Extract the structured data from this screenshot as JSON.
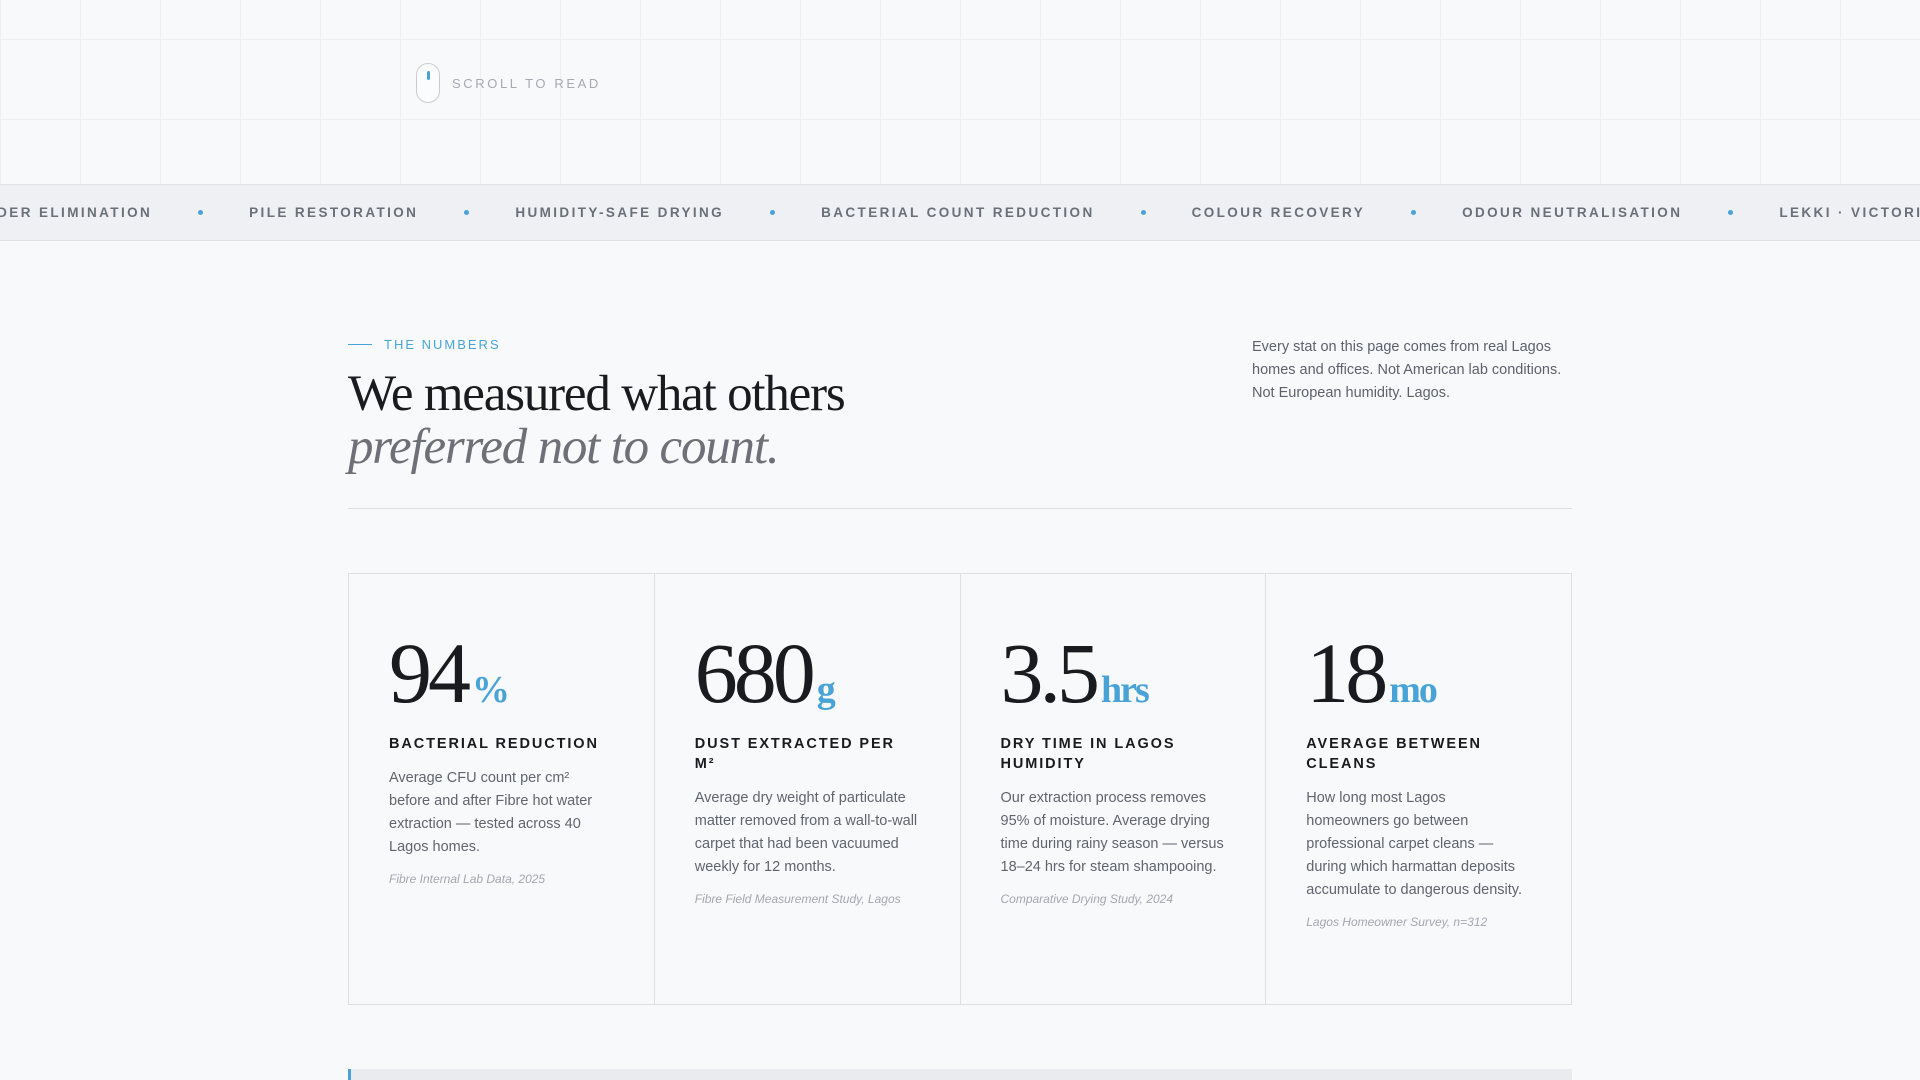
{
  "hero": {
    "scroll_label": "Scroll to read"
  },
  "ticker": {
    "items": [
      "nder elimination",
      "Pile restoration",
      "Humidity-safe drying",
      "Bacterial count reduction",
      "Colour recovery",
      "Odour neutralisation",
      "Lekki · Victoria Island · Ikoyi · Ajah · Magodo"
    ],
    "accent": "#4aa3d6"
  },
  "section": {
    "eyebrow": "The numbers",
    "headline_line1": "We measured what others",
    "headline_line2": "preferred not to count.",
    "intro": "Every stat on this page comes from real Lagos homes and offices. Not American lab conditions. Not European humidity. Lagos."
  },
  "stats": [
    {
      "value": "94",
      "unit": "%",
      "label": "Bacterial reduction",
      "description": "Average CFU count per cm² before and after Fibre hot water extraction — tested across 40 Lagos homes.",
      "source": "Fibre Internal Lab Data, 2025"
    },
    {
      "value": "680",
      "unit": "g",
      "label": "Dust extracted per m²",
      "description": "Average dry weight of particulate matter removed from a wall-to-wall carpet that had been vacuumed weekly for 12 months.",
      "source": "Fibre Field Measurement Study, Lagos"
    },
    {
      "value": "3.5",
      "unit": "hrs",
      "label": "Dry time in Lagos humidity",
      "description": "Our extraction process removes 95% of moisture. Average drying time during rainy season — versus 18–24 hrs for steam shampooing.",
      "source": "Comparative Drying Study, 2024"
    },
    {
      "value": "18",
      "unit": "mo",
      "label": "Average between cleans",
      "description": "How long most Lagos homeowners go between professional carpet cleans — during which harmattan deposits accumulate to dangerous density.",
      "source": "Lagos Homeowner Survey, n=312"
    }
  ]
}
